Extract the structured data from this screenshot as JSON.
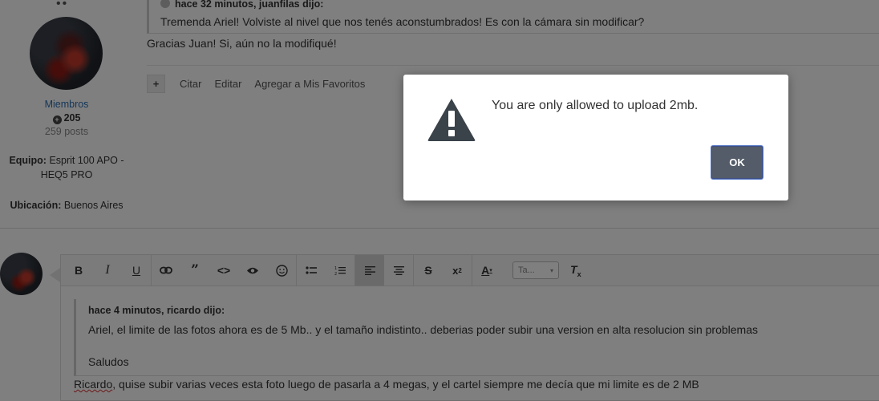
{
  "post_top": {
    "top_dots": "••",
    "author": {
      "group": "Miembros",
      "reputation": "205",
      "posts": "259 posts",
      "equipment_label": "Equipo:",
      "equipment_value": "Esprit 100 APO - HEQ5 PRO",
      "location_label": "Ubicación:",
      "location_value": "Buenos Aires"
    },
    "quote_header": "hace 32 minutos, juanfilas dijo:",
    "quote_text": "Tremenda Ariel! Volviste al nivel que nos tenés aconstumbrados! Es con la cámara sin modificar?",
    "reply_text": "Gracias Juan! Si, aún no la modifiqué!",
    "actions": {
      "plus": "+",
      "quote": "Citar",
      "edit": "Editar",
      "favorite": "Agregar a Mis Favoritos"
    }
  },
  "editor": {
    "toolbar": {
      "bold": "B",
      "italic": "I",
      "underline": "U",
      "link": "🔗",
      "quote": "99",
      "code": "<>",
      "preview": "👁",
      "emoji": "☺",
      "bullet_list": "☰",
      "numbered_list": "☷",
      "align_left": "≡",
      "align_center": "≡",
      "strike": "S",
      "superscript": "x²",
      "text_color": "A",
      "font_size_value": "Ta...",
      "clear_format": "T"
    },
    "quote_header": "hace 4 minutos, ricardo dijo:",
    "quote_text": "Ariel, el limite de las fotos ahora es de 5 Mb.. y el tamaño indistinto.. deberias poder subir una version en alta resolucion sin problemas",
    "quote_sign": "Saludos",
    "reply_first_word": "Ricardo",
    "reply_rest": ", quise subir varias veces esta foto luego de pasarla a 4 megas, y el cartel siempre me decía que mi limite es de 2 MB"
  },
  "dialog": {
    "message": "You are only allowed to upload 2mb.",
    "ok_label": "OK",
    "icon": "warning-triangle-icon",
    "accent_color": "#535c68"
  }
}
